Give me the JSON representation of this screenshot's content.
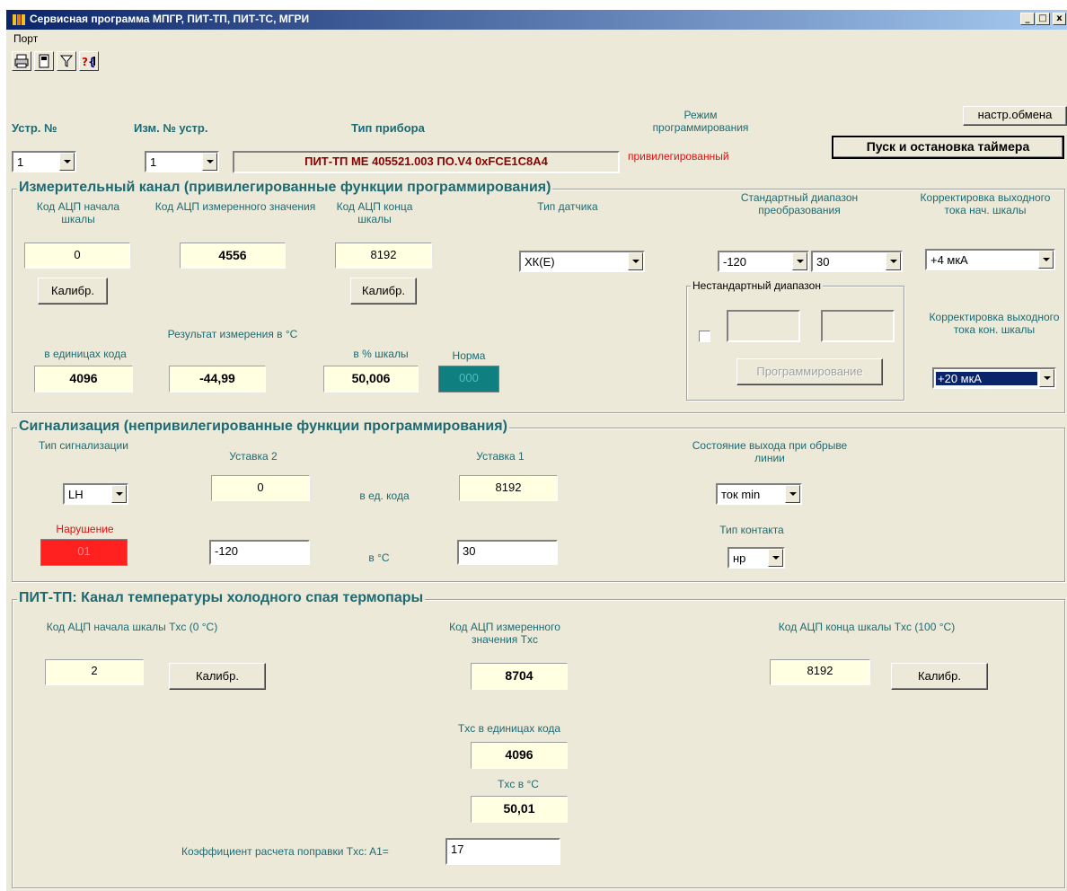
{
  "window": {
    "title": "Сервисная программа МПГР, ПИТ-ТП, ПИТ-ТС, МГРИ",
    "min": "_",
    "max": "□",
    "close": "x"
  },
  "menu": {
    "items": [
      "Порт"
    ]
  },
  "toolbar": {
    "icons": [
      "printer-icon",
      "calculator-icon",
      "filter-icon",
      "help-icon"
    ]
  },
  "header": {
    "device_no_label": "Устр. №",
    "device_no_value": "1",
    "change_no_label": "Изм. № устр.",
    "change_no_value": "1",
    "device_type_label": "Тип прибора",
    "device_type_value": "ПИТ-ТП МЕ  405521.003  ПО.V4  0xFCE1C8A4",
    "mode_label": "Режим программирования",
    "mode_value": "привилегированный",
    "exchange_settings_button": "настр.обмена",
    "timer_button": "Пуск и остановка таймера"
  },
  "measure": {
    "title": "Измерительный канал (привилегированные функции программирования)",
    "adc_start_label": "Код АЦП начала шкалы",
    "adc_start_value": "0",
    "adc_meas_label": "Код АЦП измеренного значения",
    "adc_meas_value": "4556",
    "adc_end_label": "Код АЦП конца шкалы",
    "adc_end_value": "8192",
    "calib_button": "Калибр.",
    "sensor_type_label": "Тип датчика",
    "sensor_type_value": "ХК(Е)",
    "std_range_label": "Стандартный диапазон преобразования",
    "std_range_min": "-120",
    "std_range_max": "30",
    "out_current_start_label": "Корректировка выходного тока нач. шкалы",
    "out_current_start_value": "+4 мкА",
    "nonstd_range_label": "Нестандартный диапазон",
    "program_button": "Программирование",
    "out_current_end_label": "Корректировка выходного тока кон. шкалы",
    "out_current_end_value": "+20 мкА",
    "code_units_label": "в единицах кода",
    "code_units_value": "4096",
    "result_label": "Результат измерения в °C",
    "result_value": "-44,99",
    "percent_label": "в % шкалы",
    "percent_value": "50,006",
    "norm_label": "Норма",
    "norm_value": "000"
  },
  "alarm": {
    "title": "Сигнализация (непривилегированные функции программирования)",
    "alarm_type_label": "Тип сигнализации",
    "alarm_type_value": "LH",
    "setpoint2_label": "Уставка 2",
    "setpoint2_code": "0",
    "in_code_label": "в ед. кода",
    "setpoint1_label": "Уставка 1",
    "setpoint1_code": "8192",
    "break_state_label": "Состояние выхода при обрыве линии",
    "break_state_value": "ток min",
    "violation_label": "Нарушение",
    "violation_value": "01",
    "setpoint2_temp": "-120",
    "in_c_label": "в °C",
    "setpoint1_temp": "30",
    "contact_type_label": "Тип контакта",
    "contact_type_value": "нр"
  },
  "cold": {
    "title": "ПИТ-ТП: Канал температуры холодного спая термопары",
    "adc_start_label": "Код АЦП начала шкалы Txc (0 °C)",
    "adc_start_value": "2",
    "calib_button": "Калибр.",
    "adc_meas_label": "Код АЦП измеренного значения Txc",
    "adc_meas_value": "8704",
    "adc_end_label": "Код АЦП конца шкалы Txc (100 °C)",
    "adc_end_value": "8192",
    "txc_code_label": "Txc в единицах кода",
    "txc_code_value": "4096",
    "txc_c_label": "Txc в °C",
    "txc_c_value": "50,01",
    "coef_label": "Коэффициент расчета поправки Txc:  A1=",
    "coef_value": "17"
  },
  "colors": {
    "label": "#1e6a72",
    "value_bg": "#ffffe1",
    "norm_bg": "#0f7f7f",
    "violation_bg": "#ff2020",
    "device_type_text": "#8b0000"
  }
}
